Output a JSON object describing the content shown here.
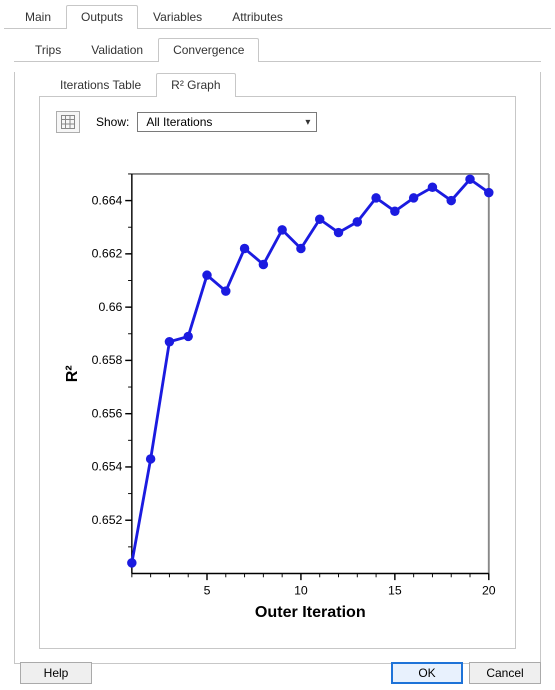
{
  "outer_tabs": {
    "t0": "Main",
    "t1": "Outputs",
    "t2": "Variables",
    "t3": "Attributes",
    "active": 1
  },
  "mid_tabs": {
    "t0": "Trips",
    "t1": "Validation",
    "t2": "Convergence",
    "active": 2
  },
  "inner_tabs": {
    "t0": "Iterations Table",
    "t1": "R² Graph",
    "active": 1
  },
  "controls": {
    "show_label": "Show:",
    "show_value": "All Iterations"
  },
  "footer": {
    "help": "Help",
    "ok": "OK",
    "cancel": "Cancel"
  },
  "chart_data": {
    "type": "line",
    "title": "",
    "xlabel": "Outer Iteration",
    "ylabel": "R²",
    "xlim": [
      1,
      20
    ],
    "ylim": [
      0.65,
      0.665
    ],
    "x_ticks": [
      5,
      10,
      15,
      20
    ],
    "y_ticks": [
      0.652,
      0.654,
      0.656,
      0.658,
      0.66,
      0.662,
      0.664
    ],
    "x": [
      1,
      2,
      3,
      4,
      5,
      6,
      7,
      8,
      9,
      10,
      11,
      12,
      13,
      14,
      15,
      16,
      17,
      18,
      19,
      20
    ],
    "y": [
      0.6504,
      0.6543,
      0.6587,
      0.6589,
      0.6612,
      0.6606,
      0.6622,
      0.6616,
      0.6629,
      0.6622,
      0.6633,
      0.6628,
      0.6632,
      0.6641,
      0.6636,
      0.6641,
      0.6645,
      0.664,
      0.6648,
      0.6643
    ]
  }
}
